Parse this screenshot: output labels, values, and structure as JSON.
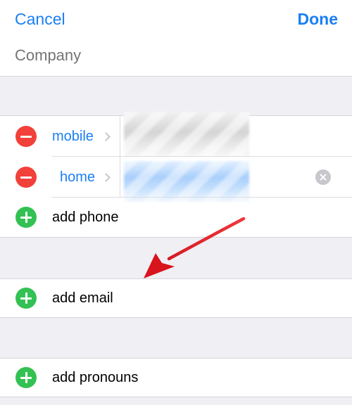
{
  "nav": {
    "cancel_label": "Cancel",
    "done_label": "Done"
  },
  "company": {
    "placeholder": "Company"
  },
  "phone_section": {
    "rows": [
      {
        "label": "mobile",
        "value_redacted": true,
        "tint": "gray"
      },
      {
        "label": "home",
        "value_redacted": true,
        "tint": "blue"
      }
    ],
    "add_label": "add phone"
  },
  "email_section": {
    "add_label": "add email"
  },
  "pronouns_section": {
    "add_label": "add pronouns"
  },
  "annotation": {
    "arrow_color": "#d8141c",
    "points_to": "add email"
  },
  "colors": {
    "accent": "#1a7ff5",
    "remove": "#f2403a",
    "add": "#33c153",
    "background": "#efeff4"
  }
}
